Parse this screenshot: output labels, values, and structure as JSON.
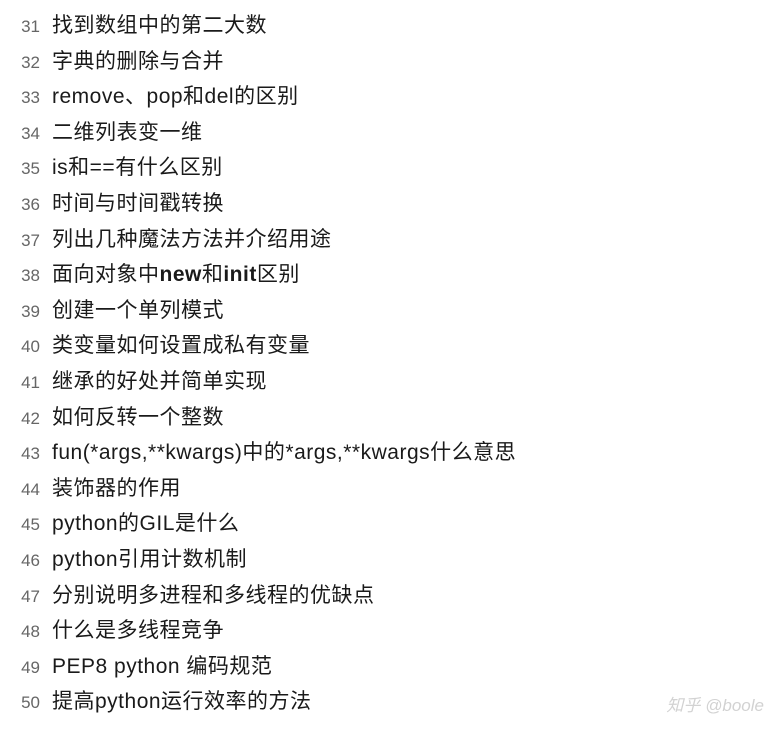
{
  "items": [
    {
      "num": "31",
      "text": "找到数组中的第二大数"
    },
    {
      "num": "32",
      "text": "字典的删除与合并"
    },
    {
      "num": "33",
      "text": "remove、pop和del的区别"
    },
    {
      "num": "34",
      "text": "二维列表变一维"
    },
    {
      "num": "35",
      "text": "is和==有什么区别"
    },
    {
      "num": "36",
      "text": "时间与时间戳转换"
    },
    {
      "num": "37",
      "text": "列出几种魔法方法并介绍用途"
    },
    {
      "num": "38",
      "text_parts": [
        {
          "t": "面向对象中",
          "b": false
        },
        {
          "t": "new",
          "b": true
        },
        {
          "t": "和",
          "b": false
        },
        {
          "t": "init",
          "b": true
        },
        {
          "t": "区别",
          "b": false
        }
      ]
    },
    {
      "num": "39",
      "text": "创建一个单列模式"
    },
    {
      "num": "40",
      "text": "类变量如何设置成私有变量"
    },
    {
      "num": "41",
      "text": "继承的好处并简单实现"
    },
    {
      "num": "42",
      "text": "如何反转一个整数"
    },
    {
      "num": "43",
      "text": "fun(*args,**kwargs)中的*args,**kwargs什么意思"
    },
    {
      "num": "44",
      "text": "装饰器的作用"
    },
    {
      "num": "45",
      "text": "python的GIL是什么"
    },
    {
      "num": "46",
      "text": "python引用计数机制"
    },
    {
      "num": "47",
      "text": "分别说明多进程和多线程的优缺点"
    },
    {
      "num": "48",
      "text": "什么是多线程竞争"
    },
    {
      "num": "49",
      "text": "PEP8 python 编码规范"
    },
    {
      "num": "50",
      "text": "提高python运行效率的方法"
    }
  ],
  "watermark": "知乎 @boole"
}
